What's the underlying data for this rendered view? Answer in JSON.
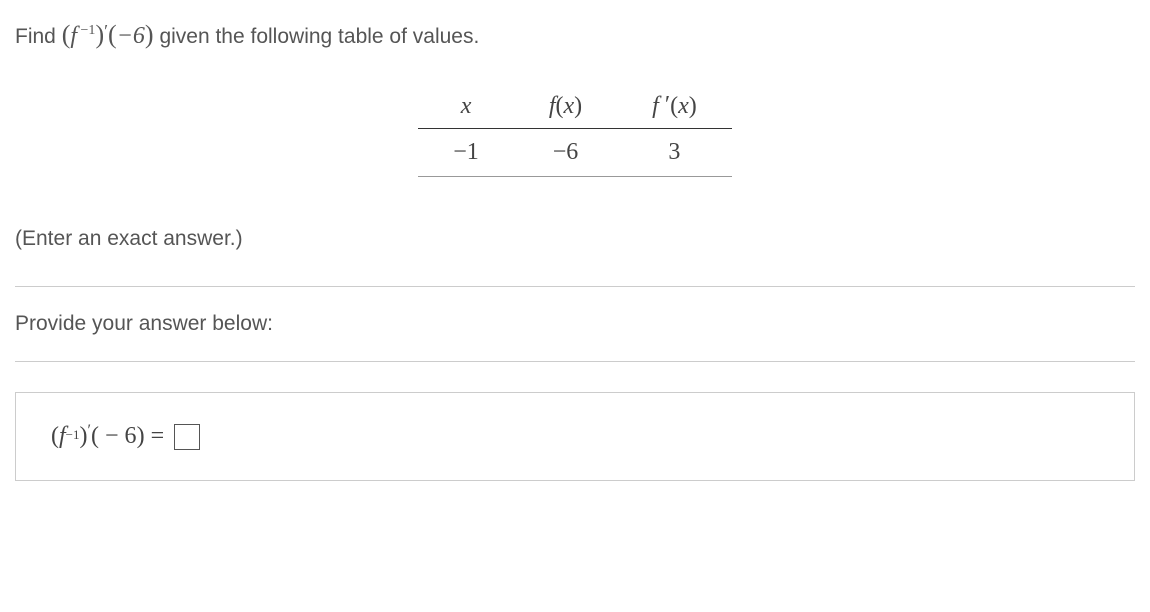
{
  "question": {
    "prefix": "Find ",
    "expr_display": "(f −1)′(−6)",
    "suffix": " given the following table of values."
  },
  "table": {
    "headers": {
      "col1": "x",
      "col2": "f(x)",
      "col3": "f ′(x)"
    },
    "rows": [
      {
        "x": "−1",
        "fx": "−6",
        "fpx": "3"
      }
    ]
  },
  "instruction": "(Enter an exact answer.)",
  "prompt": "Provide your answer below:",
  "answer": {
    "prefix": "(f −1)′( − 6) =",
    "value": ""
  },
  "chart_data": {
    "type": "table",
    "headers": [
      "x",
      "f(x)",
      "f'(x)"
    ],
    "rows": [
      [
        -1,
        -6,
        3
      ]
    ]
  }
}
